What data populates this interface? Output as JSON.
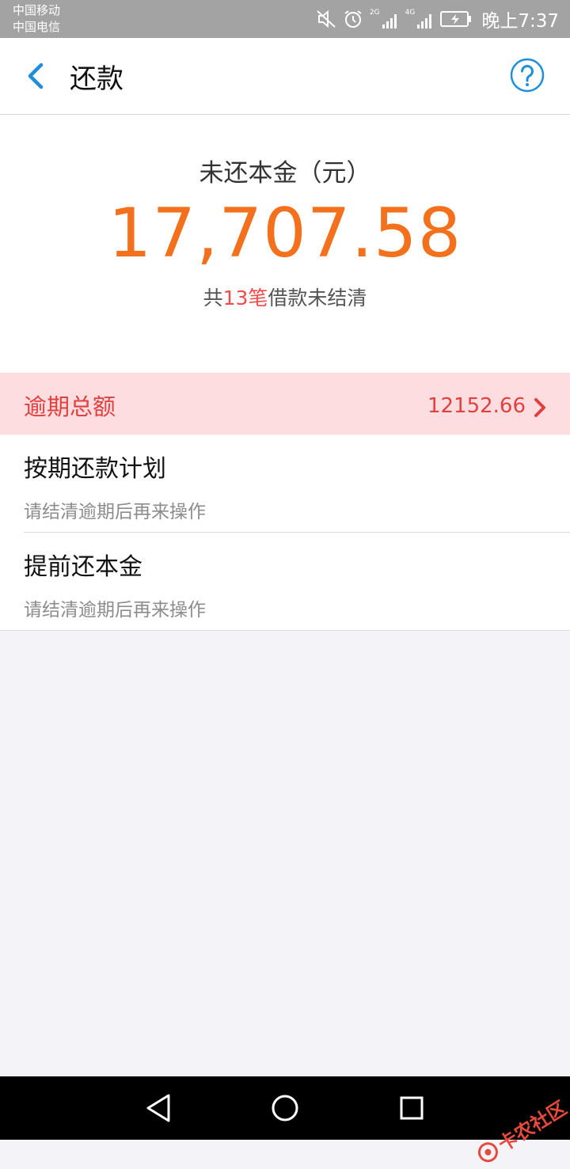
{
  "status_bar": {
    "carriers": [
      "中国移动",
      "中国电信"
    ],
    "signal_labels": [
      "2G",
      "4G"
    ],
    "time": "晚上7:37"
  },
  "header": {
    "title": "还款"
  },
  "summary": {
    "label": "未还本金（元）",
    "amount": "17,707.58",
    "count_prefix": "共",
    "count_value": "13笔",
    "count_suffix": "借款未结清"
  },
  "overdue": {
    "label": "逾期总额",
    "value": "12152.66"
  },
  "items": [
    {
      "title": "按期还款计划",
      "subtitle": "请结清逾期后再来操作"
    },
    {
      "title": "提前还本金",
      "subtitle": "请结清逾期后再来操作"
    }
  ],
  "watermark": {
    "text": "卡农社区"
  },
  "colors": {
    "accent_orange": "#f3711d",
    "overdue_red": "#e0413f",
    "link_blue": "#1e8fd8"
  }
}
